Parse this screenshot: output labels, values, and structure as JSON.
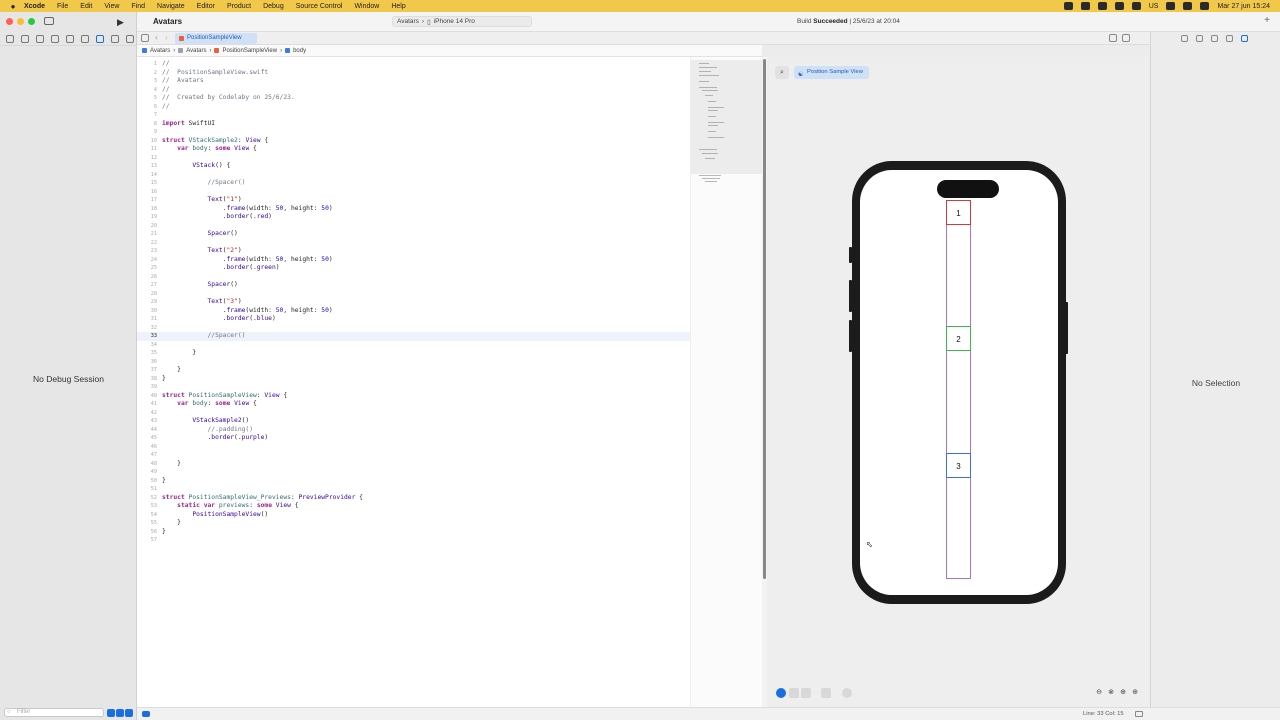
{
  "menubar": {
    "apple_icon": "apple-icon",
    "app_name": "Xcode",
    "menus": [
      "File",
      "Edit",
      "View",
      "Find",
      "Navigate",
      "Editor",
      "Product",
      "Debug",
      "Source Control",
      "Window",
      "Help"
    ],
    "input_source": "US",
    "clock": "Mar 27 jun 15:24"
  },
  "window": {
    "project_title": "Avatars",
    "scheme": {
      "project": "Avatars",
      "device": "iPhone 14 Pro"
    },
    "build_status_prefix": "Build",
    "build_status_word": "Succeeded",
    "build_status_suffix": "| 25/6/23 at 20:04"
  },
  "tabs": {
    "active_tab": "PositionSampleView"
  },
  "breadcrumb": {
    "items": [
      "Avatars",
      "Avatars",
      "PositionSampleView",
      "body"
    ]
  },
  "debug": {
    "no_session": "No Debug Session",
    "filter_placeholder": "Filter"
  },
  "editor": {
    "current_line": 33,
    "line_numbers": [
      "1",
      "2",
      "3",
      "4",
      "5",
      "6",
      "7",
      "8",
      "9",
      "10",
      "11",
      "12",
      "13",
      "14",
      "15",
      "16",
      "17",
      "18",
      "19",
      "20",
      "21",
      "22",
      "23",
      "24",
      "25",
      "26",
      "27",
      "28",
      "29",
      "30",
      "31",
      "32",
      "33",
      "34",
      "35",
      "36",
      "37",
      "38",
      "39",
      "40",
      "41",
      "42",
      "43",
      "44",
      "45",
      "46",
      "47",
      "48",
      "49",
      "50",
      "51",
      "52",
      "53",
      "54",
      "55",
      "56",
      "57"
    ]
  },
  "canvas": {
    "preview_chip": "Position Sample View",
    "phone_texts": [
      "1",
      "2",
      "3"
    ],
    "border_colors": {
      "red": "#d93636",
      "green": "#3ab74a",
      "blue": "#3d6de0",
      "purple": "#b271c8"
    }
  },
  "inspector": {
    "no_selection": "No Selection"
  },
  "footer": {
    "position": "Line: 33  Col: 15"
  }
}
